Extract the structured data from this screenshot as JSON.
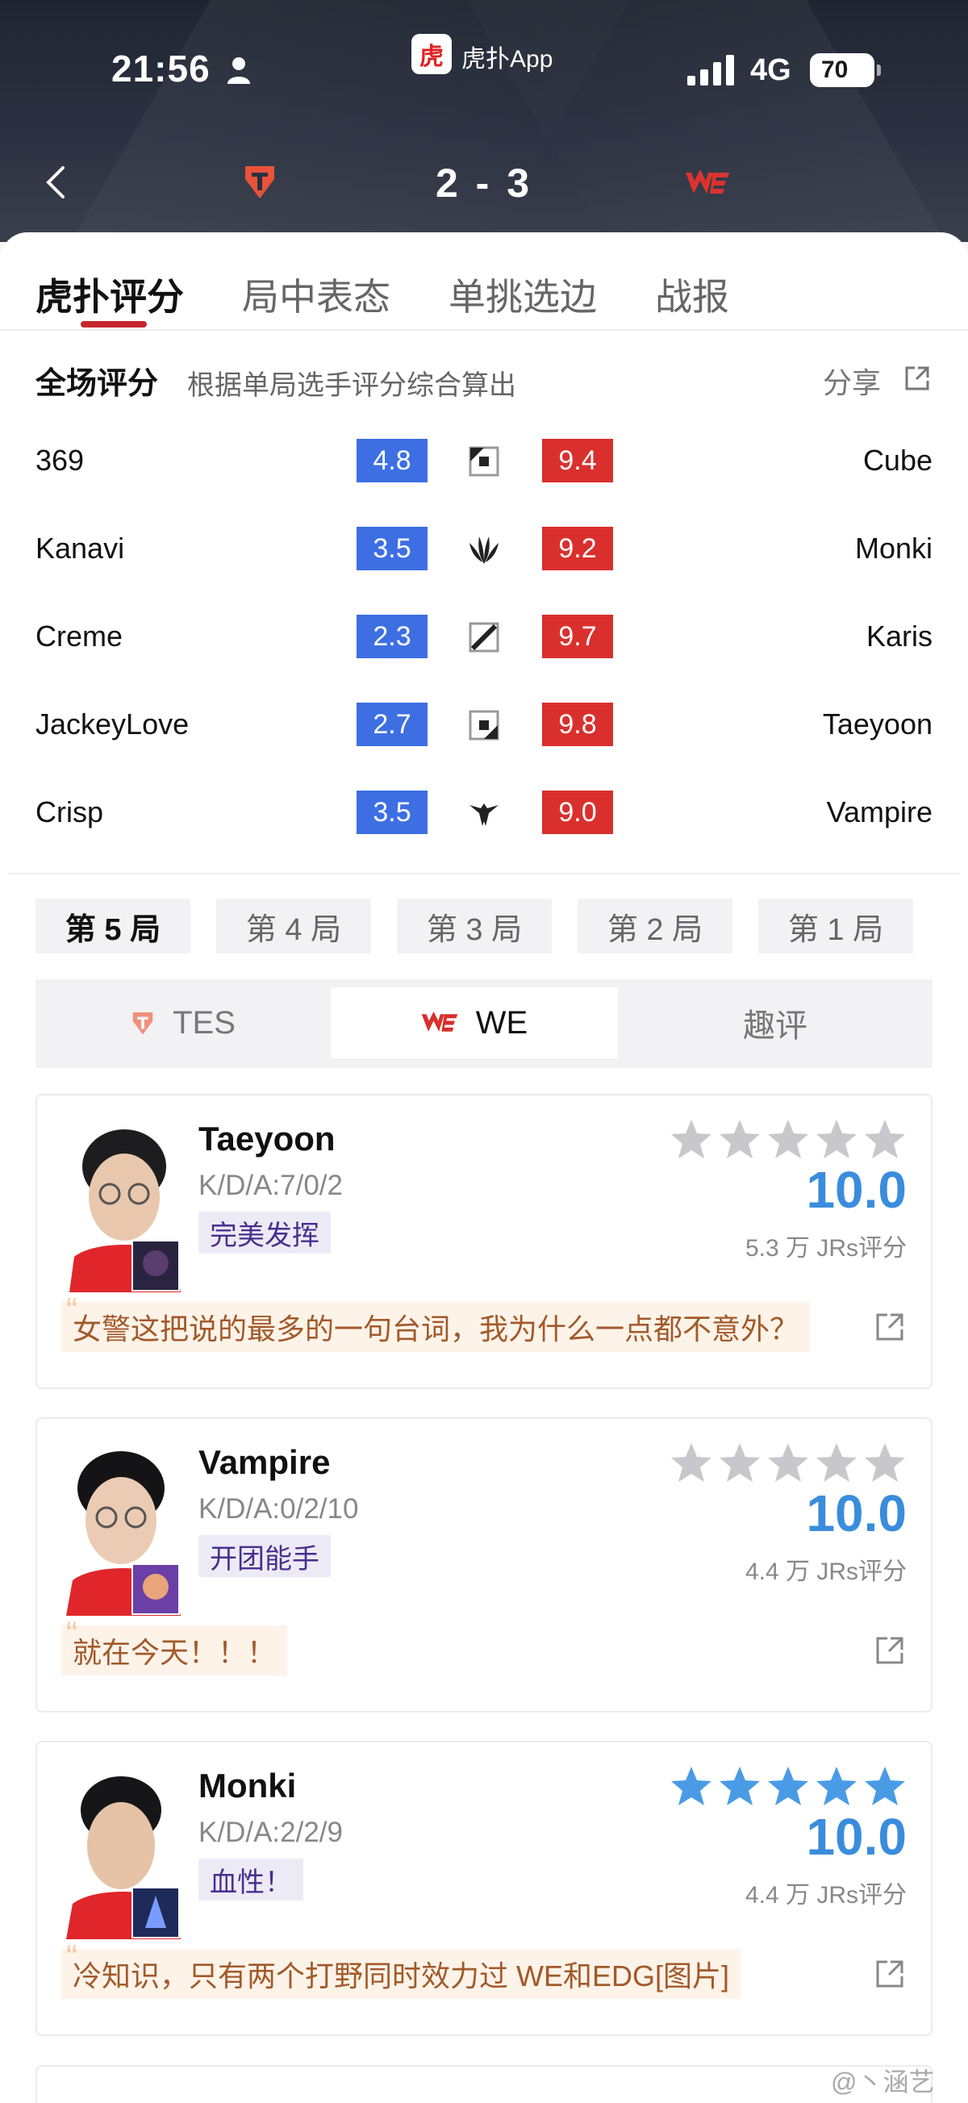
{
  "status_bar": {
    "time": "21:56",
    "app_badge": "虎",
    "app_name": "虎扑App",
    "network": "4G",
    "battery": "70"
  },
  "header": {
    "score": "2 - 3",
    "left_team_icon": "tes-logo-icon",
    "right_team_icon": "we-logo-icon"
  },
  "tabs": [
    {
      "label": "虎扑评分",
      "active": true
    },
    {
      "label": "局中表态",
      "active": false
    },
    {
      "label": "单挑选边",
      "active": false
    },
    {
      "label": "战报",
      "active": false
    }
  ],
  "overall": {
    "title": "全场评分",
    "subtitle": "根据单局选手评分综合算出",
    "share": "分享",
    "rows": [
      {
        "left_player": "369",
        "left_score": "4.8",
        "role_icon": "top-lane-icon",
        "right_score": "9.4",
        "right_player": "Cube"
      },
      {
        "left_player": "Kanavi",
        "left_score": "3.5",
        "role_icon": "jungle-icon",
        "right_score": "9.2",
        "right_player": "Monki"
      },
      {
        "left_player": "Creme",
        "left_score": "2.3",
        "role_icon": "mid-lane-icon",
        "right_score": "9.7",
        "right_player": "Karis"
      },
      {
        "left_player": "JackeyLove",
        "left_score": "2.7",
        "role_icon": "bot-lane-icon",
        "right_score": "9.8",
        "right_player": "Taeyoon"
      },
      {
        "left_player": "Crisp",
        "left_score": "3.5",
        "role_icon": "support-icon",
        "right_score": "9.0",
        "right_player": "Vampire"
      }
    ]
  },
  "games": [
    {
      "label": "第 5 局",
      "active": true
    },
    {
      "label": "第 4 局",
      "active": false
    },
    {
      "label": "第 3 局",
      "active": false
    },
    {
      "label": "第 2 局",
      "active": false
    },
    {
      "label": "第 1 局",
      "active": false
    }
  ],
  "teams": [
    {
      "label": "TES",
      "active": false
    },
    {
      "label": "WE",
      "active": true
    },
    {
      "label": "趣评",
      "active": false
    }
  ],
  "players": [
    {
      "name": "Taeyoon",
      "kda": "K/D/A:7/0/2",
      "tag": "完美发挥",
      "score": "10.0",
      "votes": "5.3 万 JRs评分",
      "stars_filled": 0,
      "comment": "女警这把说的最多的一句台词，我为什么一点都不意外？"
    },
    {
      "name": "Vampire",
      "kda": "K/D/A:0/2/10",
      "tag": "开团能手",
      "score": "10.0",
      "votes": "4.4 万 JRs评分",
      "stars_filled": 0,
      "comment": "就在今天！！！"
    },
    {
      "name": "Monki",
      "kda": "K/D/A:2/2/9",
      "tag": "血性！",
      "score": "10.0",
      "votes": "4.4 万 JRs评分",
      "stars_filled": 5,
      "comment": "冷知识，只有两个打野同时效力过 WE和EDG[图片]"
    }
  ],
  "watermark": "@丶涵艺",
  "colors": {
    "blue_score": "#3d6fe3",
    "red_score": "#d9302d",
    "accent": "#c6262e",
    "rating_blue": "#3a8ddc",
    "star_gray": "#c8c8cc"
  }
}
